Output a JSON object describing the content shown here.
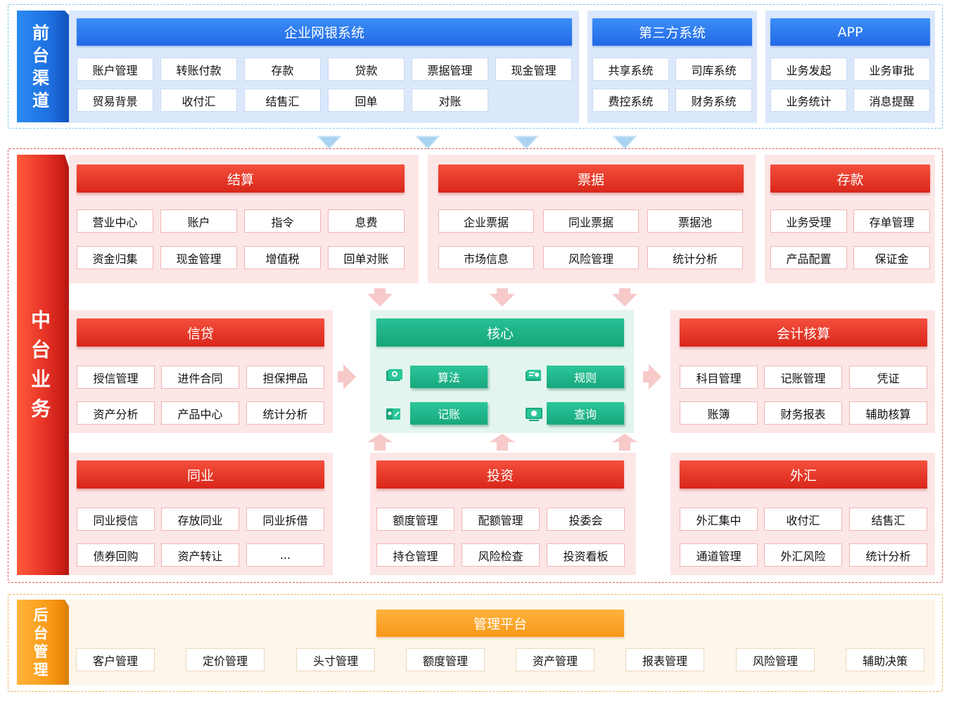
{
  "front": {
    "side_label": [
      "前",
      "台",
      "渠",
      "道"
    ],
    "bank_system": {
      "title": "企业网银系统",
      "items": [
        "账户管理",
        "转账付款",
        "存款",
        "贷款",
        "票据管理",
        "现金管理",
        "贸易背景",
        "收付汇",
        "结售汇",
        "回单",
        "对账"
      ]
    },
    "third_party": {
      "title": "第三方系统",
      "items": [
        "共享系统",
        "司库系统",
        "费控系统",
        "财务系统"
      ]
    },
    "app": {
      "title": "APP",
      "items": [
        "业务发起",
        "业务审批",
        "业务统计",
        "消息提醒"
      ]
    }
  },
  "middle": {
    "side_label": [
      "中",
      "台",
      "业",
      "务"
    ],
    "settlement": {
      "title": "结算",
      "items": [
        "营业中心",
        "账户",
        "指令",
        "息费",
        "资金归集",
        "现金管理",
        "增值税",
        "回单对账"
      ]
    },
    "bills": {
      "title": "票据",
      "items": [
        "企业票据",
        "同业票据",
        "票据池",
        "市场信息",
        "风险管理",
        "统计分析"
      ]
    },
    "deposit": {
      "title": "存款",
      "items": [
        "业务受理",
        "存单管理",
        "产品配置",
        "保证金"
      ]
    },
    "credit": {
      "title": "信贷",
      "items": [
        "授信管理",
        "进件合同",
        "担保押品",
        "资产分析",
        "产品中心",
        "统计分析"
      ]
    },
    "core": {
      "title": "核心",
      "items": [
        "算法",
        "规则",
        "记账",
        "查询"
      ]
    },
    "accounting": {
      "title": "会计核算",
      "items": [
        "科目管理",
        "记账管理",
        "凭证",
        "账簿",
        "财务报表",
        "辅助核算"
      ]
    },
    "interbank": {
      "title": "同业",
      "items": [
        "同业授信",
        "存放同业",
        "同业拆借",
        "债券回购",
        "资产转让",
        "..."
      ]
    },
    "investment": {
      "title": "投资",
      "items": [
        "额度管理",
        "配额管理",
        "投委会",
        "持仓管理",
        "风险检查",
        "投资看板"
      ]
    },
    "forex": {
      "title": "外汇",
      "items": [
        "外汇集中",
        "收付汇",
        "结售汇",
        "通道管理",
        "外汇风险",
        "统计分析"
      ]
    }
  },
  "back": {
    "side_label": [
      "后",
      "台",
      "管",
      "理"
    ],
    "platform": {
      "title": "管理平台",
      "items": [
        "客户管理",
        "定价管理",
        "头寸管理",
        "额度管理",
        "资产管理",
        "报表管理",
        "风险管理",
        "辅助决策"
      ]
    }
  },
  "icons": {
    "core": [
      "algorithm-icon",
      "rule-icon",
      "bookkeeping-icon",
      "query-icon"
    ],
    "arrows": "chevron-arrow-icon"
  },
  "colors": {
    "front_accent": "#2269e6",
    "middle_accent": "#d8261a",
    "core_accent": "#17a57b",
    "back_accent": "#f7981a"
  }
}
